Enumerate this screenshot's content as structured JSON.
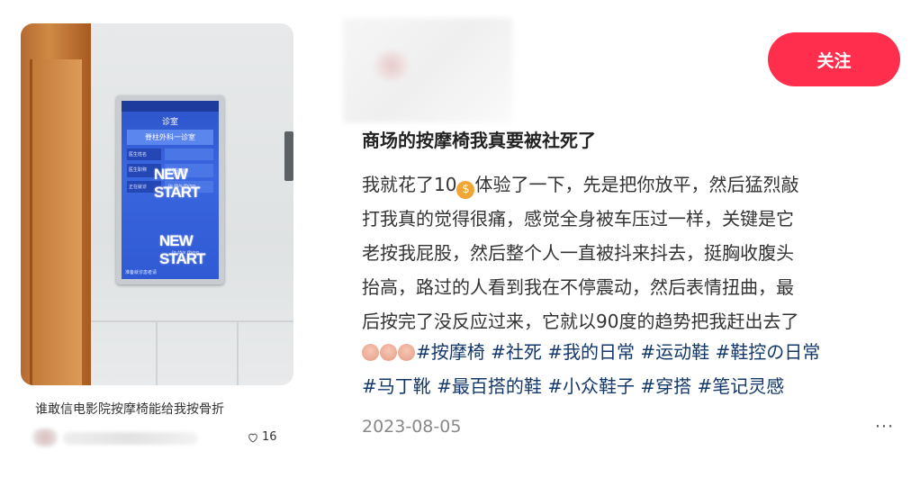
{
  "left_card": {
    "screen": {
      "room": "诊室",
      "dept": "脊柱外科一诊室",
      "rows": [
        {
          "k": "医生姓名",
          "v": ""
        },
        {
          "k": "医生职称",
          "v": "主任医师"
        },
        {
          "k": "正在就诊",
          "v": ""
        }
      ],
      "footer": "准备就诊患者请",
      "logo": "NEW START",
      "logo_sub": "In this thing"
    },
    "title": "谁敢信电影院按摩椅能给我按骨折",
    "likes": "16",
    "like_icon": "heart-outline-icon"
  },
  "detail": {
    "follow_label": "关注",
    "follow_color": "#ff2e4d",
    "title": "商场的按摩椅我真要被社死了",
    "body_lines": [
      "我就花了10",
      "体验了一下，先是把你放平，然后猛烈敲",
      "打我真的觉得很痛，感觉全身被车压过一样，关键是它",
      "老按我屁股，然后整个人一直被抖来抖去，挺胸收腹头",
      "抬高，路过的人看到我在不停震动，然后表情扭曲，最",
      "后按完了没反应过来，它就以90度的趋势把我赶出去了"
    ],
    "money_icon": "money-bag-icon",
    "tags_line1": [
      "#按摩椅",
      "#社死",
      "#我的日常",
      "#运动鞋",
      "#鞋控の日常"
    ],
    "tags_line2": [
      "#马丁靴",
      "#最百搭的鞋",
      "#小众鞋子",
      "#穿搭",
      "#笔记灵感"
    ],
    "tag_color": "#13386c",
    "date": "2023-08-05",
    "more_label": "···"
  }
}
